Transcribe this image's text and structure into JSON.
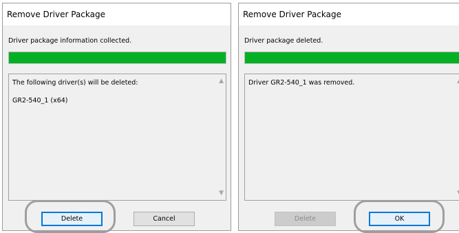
{
  "left_dialog": {
    "title": "Remove Driver Package",
    "status": "Driver package information collected.",
    "progress": 1.0,
    "lines": [
      "The following driver(s) will be deleted:",
      "GR2-540_1 (x64)"
    ],
    "buttons": {
      "primary": "Delete",
      "secondary": "Cancel"
    }
  },
  "right_dialog": {
    "title": "Remove Driver Package",
    "status": "Driver package deleted.",
    "progress": 1.0,
    "lines": [
      "Driver GR2-540_1 was removed."
    ],
    "buttons": {
      "disabled": "Delete",
      "primary": "OK"
    }
  },
  "icons": {
    "scroll_up": "▲",
    "scroll_down": "▼"
  },
  "colors": {
    "progress_fill": "#06b025",
    "primary_button_border": "#0078d7",
    "highlight_ring": "#9e9e9e"
  }
}
